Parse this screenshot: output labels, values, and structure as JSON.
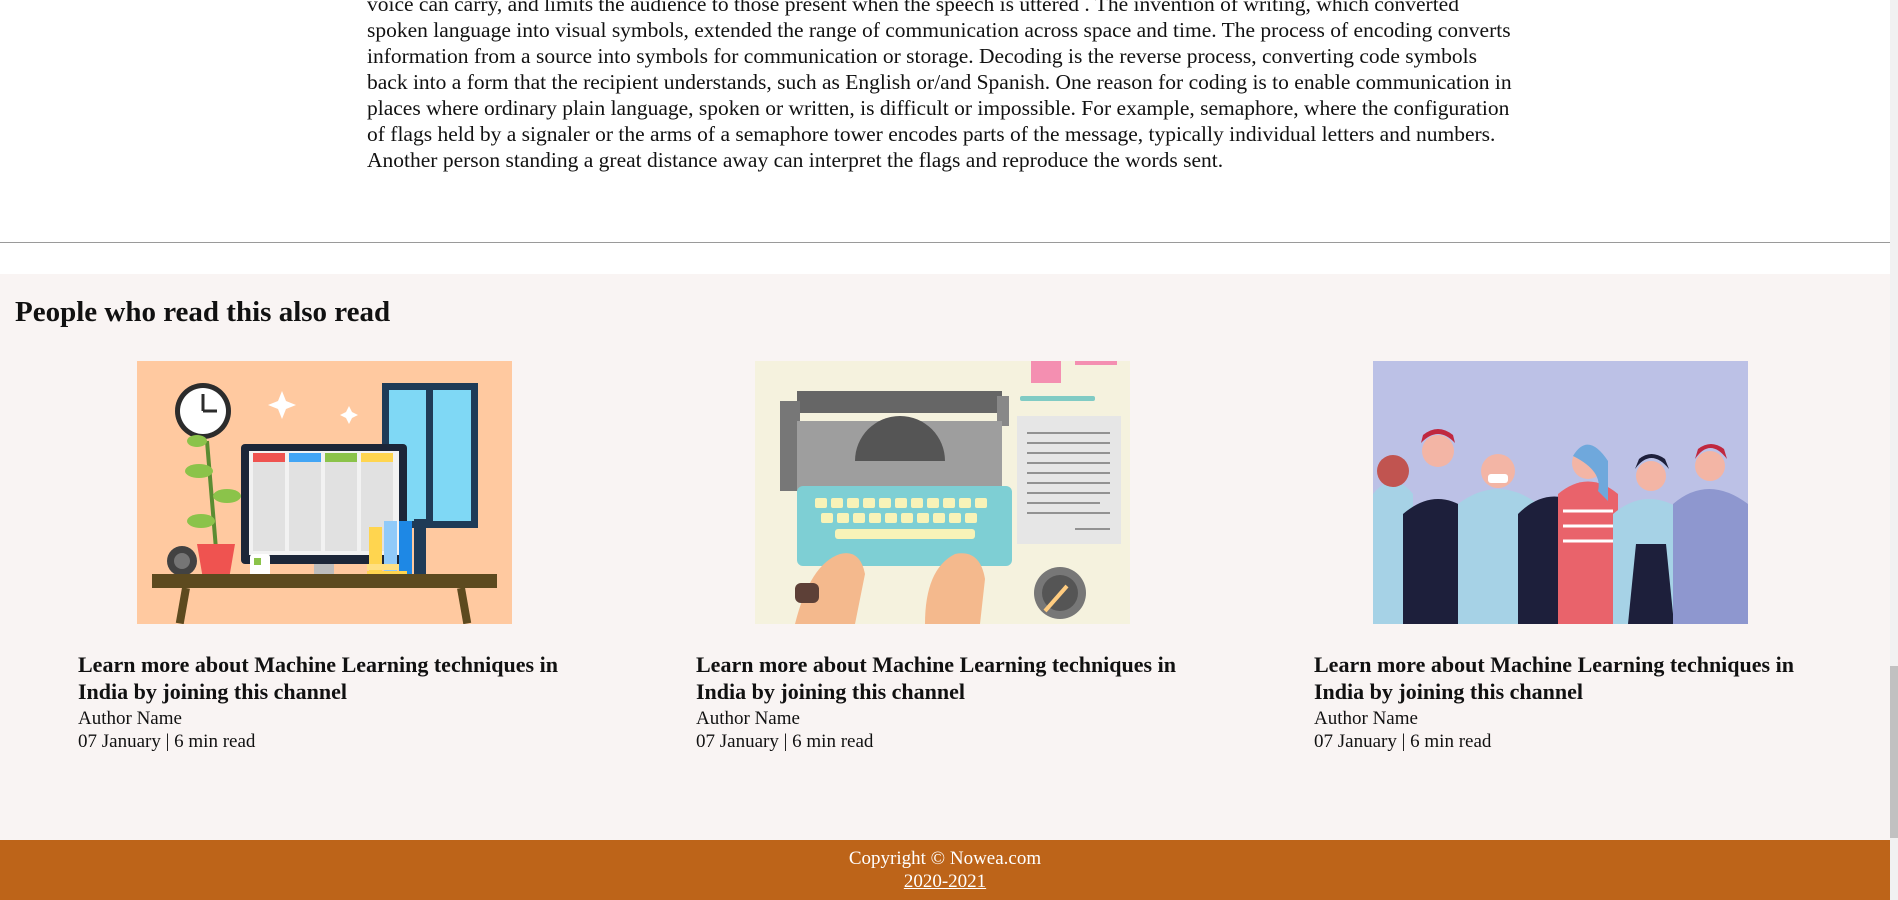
{
  "article": {
    "text": "voice can carry, and limits the audience to those present when the speech is uttered . The invention of writing, which converted spoken language into visual symbols, extended the range of communication across space and time. The process of encoding converts information from a source into symbols for communication or storage. Decoding is the reverse process, converting code symbols back into a form that the recipient understands, such as English or/and Spanish. One reason for coding is to enable communication in places where ordinary plain language, spoken or written, is difficult or impossible. For example, semaphore, where the configuration of flags held by a signaler or the arms of a semaphore tower encodes parts of the message, typically individual letters and numbers. Another person standing a great distance away can interpret the flags and reproduce the words sent."
  },
  "related": {
    "heading": "People who read this also read",
    "cards": [
      {
        "title": "Learn more about Machine Learning techniques in India by joining this channel",
        "author": "Author Name",
        "meta": "07 January | 6 min read",
        "image": "workspace-desk-illustration"
      },
      {
        "title": "Learn more about Machine Learning techniques in India by joining this channel",
        "author": "Author Name",
        "meta": "07 January | 6 min read",
        "image": "typewriter-illustration"
      },
      {
        "title": "Learn more about Machine Learning techniques in India by joining this channel",
        "author": "Author Name",
        "meta": "07 January | 6 min read",
        "image": "crowd-with-masks-illustration"
      }
    ]
  },
  "footer": {
    "copyright": "Copyright © Nowea.com",
    "years": "2020-2021"
  },
  "colors": {
    "footer_bg": "#bd6419",
    "section_bg": "#f9f4f3"
  }
}
